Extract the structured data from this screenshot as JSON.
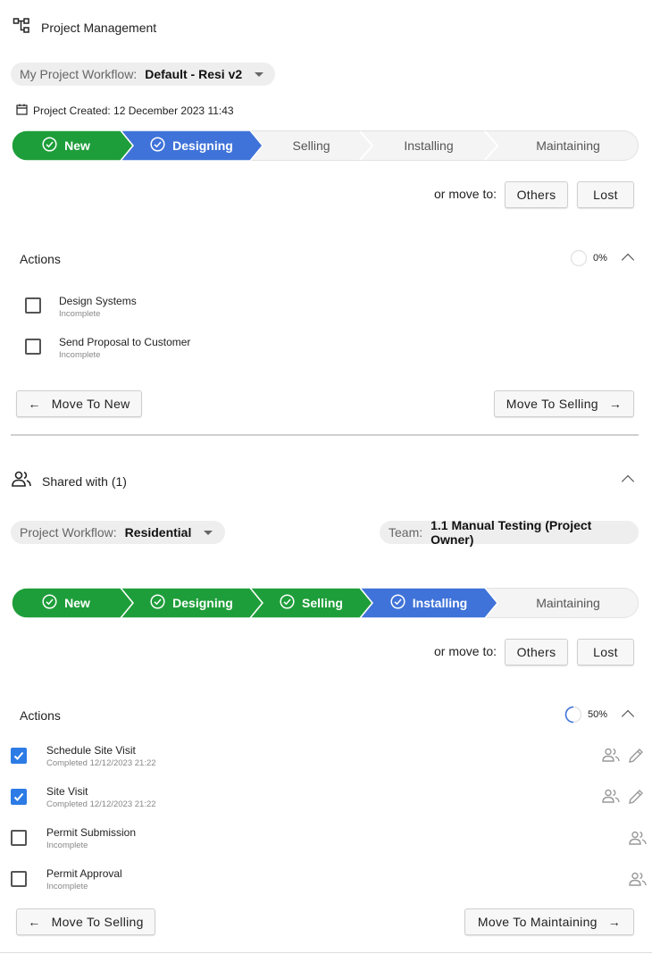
{
  "header": {
    "title": "Project Management",
    "icon": "hierarchy-icon"
  },
  "my_workflow": {
    "label": "My Project Workflow:",
    "value": "Default - Resi v2"
  },
  "created": {
    "text": "Project Created: 12 December 2023 11:43"
  },
  "stepper1": {
    "steps": [
      "New",
      "Designing",
      "Selling",
      "Installing",
      "Maintaining"
    ],
    "completed_count": 2,
    "colors": {
      "done": "#1e9e3a",
      "current": "#3f73d9",
      "todo": "#f4f4f4"
    }
  },
  "move1": {
    "label": "or move to:",
    "others": "Others",
    "lost": "Lost"
  },
  "actions1": {
    "title": "Actions",
    "progress": "0%",
    "progress_fraction": 0,
    "tasks": [
      {
        "name": "Design Systems",
        "status": "Incomplete",
        "checked": false
      },
      {
        "name": "Send Proposal to Customer",
        "status": "Incomplete",
        "checked": false
      }
    ],
    "back_button": "Move To New",
    "next_button": "Move To Selling"
  },
  "shared": {
    "title": "Shared with (1)"
  },
  "workflow2": {
    "label": "Project Workflow:",
    "value": "Residential"
  },
  "team": {
    "label": "Team:",
    "value": "1.1 Manual Testing (Project Owner)"
  },
  "stepper2": {
    "steps": [
      "New",
      "Designing",
      "Selling",
      "Installing",
      "Maintaining"
    ],
    "completed_count": 4
  },
  "move2": {
    "label": "or move to:",
    "others": "Others",
    "lost": "Lost"
  },
  "actions2": {
    "title": "Actions",
    "progress": "50%",
    "progress_fraction": 0.5,
    "tasks": [
      {
        "name": "Schedule Site Visit",
        "status": "Completed 12/12/2023 21:22",
        "checked": true
      },
      {
        "name": "Site Visit",
        "status": "Completed 12/12/2023 21:22",
        "checked": true
      },
      {
        "name": "Permit Submission",
        "status": "Incomplete",
        "checked": false
      },
      {
        "name": "Permit Approval",
        "status": "Incomplete",
        "checked": false
      }
    ],
    "back_button": "Move To Selling",
    "next_button": "Move To Maintaining"
  }
}
